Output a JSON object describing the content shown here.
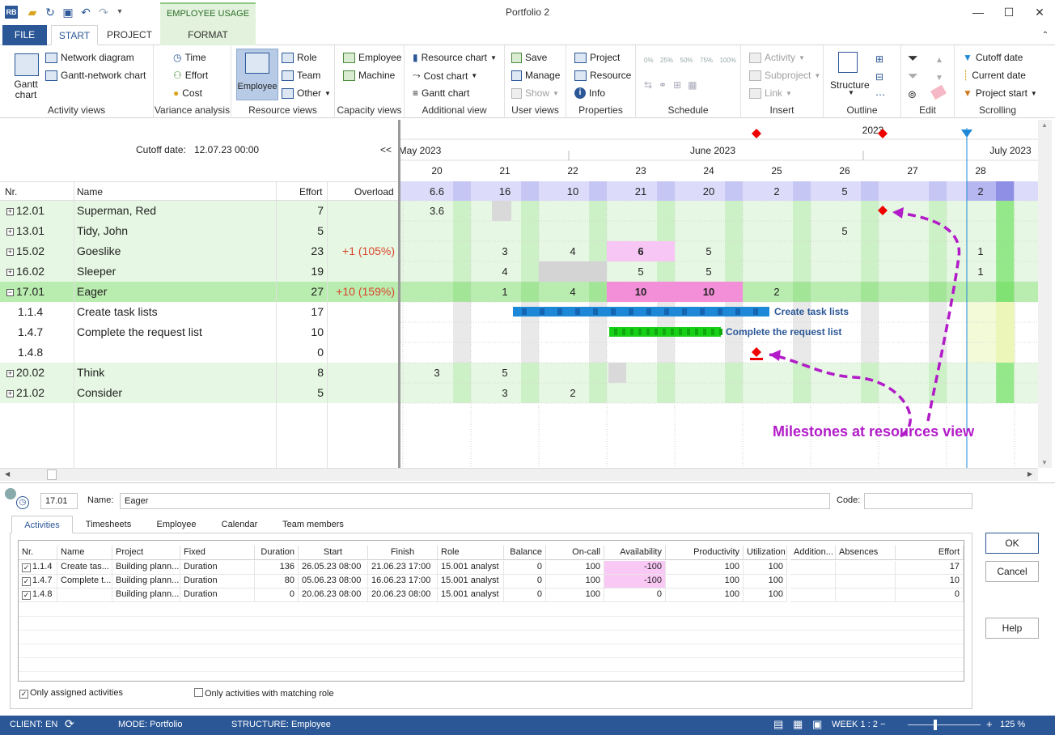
{
  "window": {
    "title": "Portfolio 2",
    "context_tab": "EMPLOYEE USAGE"
  },
  "tabs": {
    "file": "FILE",
    "start": "START",
    "project": "PROJECT",
    "format": "FORMAT"
  },
  "ribbon": {
    "activity_views": {
      "label": "Activity views",
      "gantt": "Gantt chart",
      "network": "Network diagram",
      "gantt_network": "Gantt-network chart"
    },
    "variance": {
      "label": "Variance analysis",
      "time": "Time",
      "effort": "Effort",
      "cost": "Cost"
    },
    "resource_views": {
      "label": "Resource views",
      "employee": "Employee",
      "role": "Role",
      "team": "Team",
      "other": "Other"
    },
    "capacity_views": {
      "label": "Capacity views",
      "employee": "Employee",
      "machine": "Machine"
    },
    "additional_view": {
      "label": "Additional view",
      "resource_chart": "Resource chart",
      "cost_chart": "Cost chart",
      "gantt_chart": "Gantt chart"
    },
    "user_views": {
      "label": "User views",
      "save": "Save",
      "manage": "Manage",
      "show": "Show"
    },
    "properties": {
      "label": "Properties",
      "project": "Project",
      "resource": "Resource",
      "info": "Info"
    },
    "schedule": {
      "label": "Schedule",
      "p0": "0%",
      "p25": "25%",
      "p50": "50%",
      "p75": "75%",
      "p100": "100%"
    },
    "insert": {
      "label": "Insert",
      "activity": "Activity",
      "subproject": "Subproject",
      "link": "Link"
    },
    "outline": {
      "label": "Outline",
      "structure": "Structure"
    },
    "edit": {
      "label": "Edit"
    },
    "scrolling": {
      "label": "Scrolling",
      "cutoff": "Cutoff date",
      "current": "Current date",
      "project_start": "Project start"
    }
  },
  "grid": {
    "cutoff_label": "Cutoff date:",
    "cutoff_value": "12.07.23 00:00",
    "collapse": "<<",
    "headers": {
      "nr": "Nr.",
      "name": "Name",
      "effort": "Effort",
      "overload": "Overload"
    },
    "rows": [
      {
        "nr": "12.01",
        "name": "Superman, Red",
        "effort": "7",
        "overload": "",
        "expander": "+"
      },
      {
        "nr": "13.01",
        "name": "Tidy, John",
        "effort": "5",
        "overload": "",
        "expander": "+"
      },
      {
        "nr": "15.02",
        "name": "Goeslike",
        "effort": "23",
        "overload": "+1 (105%)",
        "expander": "+"
      },
      {
        "nr": "16.02",
        "name": "Sleeper",
        "effort": "19",
        "overload": "",
        "expander": "+"
      },
      {
        "nr": "17.01",
        "name": "Eager",
        "effort": "27",
        "overload": "+10 (159%)",
        "expander": "−"
      },
      {
        "nr": "1.1.4",
        "name": "Create task lists",
        "effort": "17",
        "overload": "",
        "expander": ""
      },
      {
        "nr": "1.4.7",
        "name": "Complete the request list",
        "effort": "10",
        "overload": "",
        "expander": ""
      },
      {
        "nr": "1.4.8",
        "name": "",
        "effort": "0",
        "overload": "",
        "expander": ""
      },
      {
        "nr": "20.02",
        "name": "Think",
        "effort": "8",
        "overload": "",
        "expander": "+"
      },
      {
        "nr": "21.02",
        "name": "Consider",
        "effort": "5",
        "overload": "",
        "expander": "+"
      }
    ]
  },
  "timeline": {
    "year": "2023",
    "months": [
      "May 2023",
      "June 2023",
      "July 2023"
    ],
    "weeks": [
      "20",
      "21",
      "22",
      "23",
      "24",
      "25",
      "26",
      "27",
      "28"
    ],
    "totals": [
      "6.6",
      "16",
      "10",
      "21",
      "20",
      "2",
      "5",
      "",
      "2"
    ],
    "cells": [
      [
        "3.6",
        "",
        "",
        "",
        "",
        "",
        "",
        "",
        ""
      ],
      [
        "",
        "",
        "",
        "",
        "",
        "",
        "5",
        "",
        ""
      ],
      [
        "",
        "3",
        "4",
        "6",
        "5",
        "",
        "",
        "",
        "1"
      ],
      [
        "",
        "4",
        "",
        "5",
        "5",
        "",
        "",
        "",
        "1"
      ],
      [
        "",
        "1",
        "4",
        "10",
        "10",
        "2",
        "",
        "",
        ""
      ],
      [
        "",
        "",
        "",
        "",
        "",
        "",
        "",
        "",
        ""
      ],
      [
        "",
        "",
        "",
        "",
        "",
        "",
        "",
        "",
        ""
      ],
      [
        "",
        "",
        "",
        "",
        "",
        "",
        "",
        "",
        ""
      ],
      [
        "3",
        "5",
        "",
        "",
        "",
        "",
        "",
        "",
        ""
      ],
      [
        "",
        "3",
        "2",
        "",
        "",
        "",
        "",
        "",
        ""
      ]
    ],
    "bar_labels": {
      "task1": "Create task lists",
      "task2": "Complete the request list"
    },
    "annotation": "Milestones at resources view"
  },
  "detail": {
    "nr": "17.01",
    "name_label": "Name:",
    "name_value": "Eager",
    "code_label": "Code:",
    "code_value": "",
    "tabs": [
      "Activities",
      "Timesheets",
      "Employee",
      "Calendar",
      "Team members"
    ],
    "columns": [
      "Nr.",
      "Name",
      "Project",
      "Fixed",
      "Duration",
      "Start",
      "Finish",
      "Role",
      "Balance",
      "On-call",
      "Availability",
      "Productivity",
      "Utilization",
      "Addition...",
      "Absences",
      "Effort"
    ],
    "rows": [
      [
        "1.1.4",
        "Create tas...",
        "Building plann...",
        "Duration",
        "136",
        "26.05.23 08:00",
        "21.06.23 17:00",
        "15.001 analyst",
        "0",
        "100",
        "-100",
        "100",
        "100",
        "",
        "",
        "17"
      ],
      [
        "1.4.7",
        "Complete t...",
        "Building plann...",
        "Duration",
        "80",
        "05.06.23 08:00",
        "16.06.23 17:00",
        "15.001 analyst",
        "0",
        "100",
        "-100",
        "100",
        "100",
        "",
        "",
        "10"
      ],
      [
        "1.4.8",
        "",
        "Building plann...",
        "Duration",
        "0",
        "20.06.23 08:00",
        "20.06.23 08:00",
        "15.001 analyst",
        "0",
        "100",
        "0",
        "100",
        "100",
        "",
        "",
        "0"
      ]
    ],
    "only_assigned": "Only assigned activities",
    "only_matching": "Only activities with matching role",
    "ok": "OK",
    "cancel": "Cancel",
    "help": "Help"
  },
  "status": {
    "client": "CLIENT: EN",
    "mode": "MODE: Portfolio",
    "structure": "STRUCTURE: Employee",
    "week": "WEEK 1 : 2",
    "zoom": "125 %"
  }
}
